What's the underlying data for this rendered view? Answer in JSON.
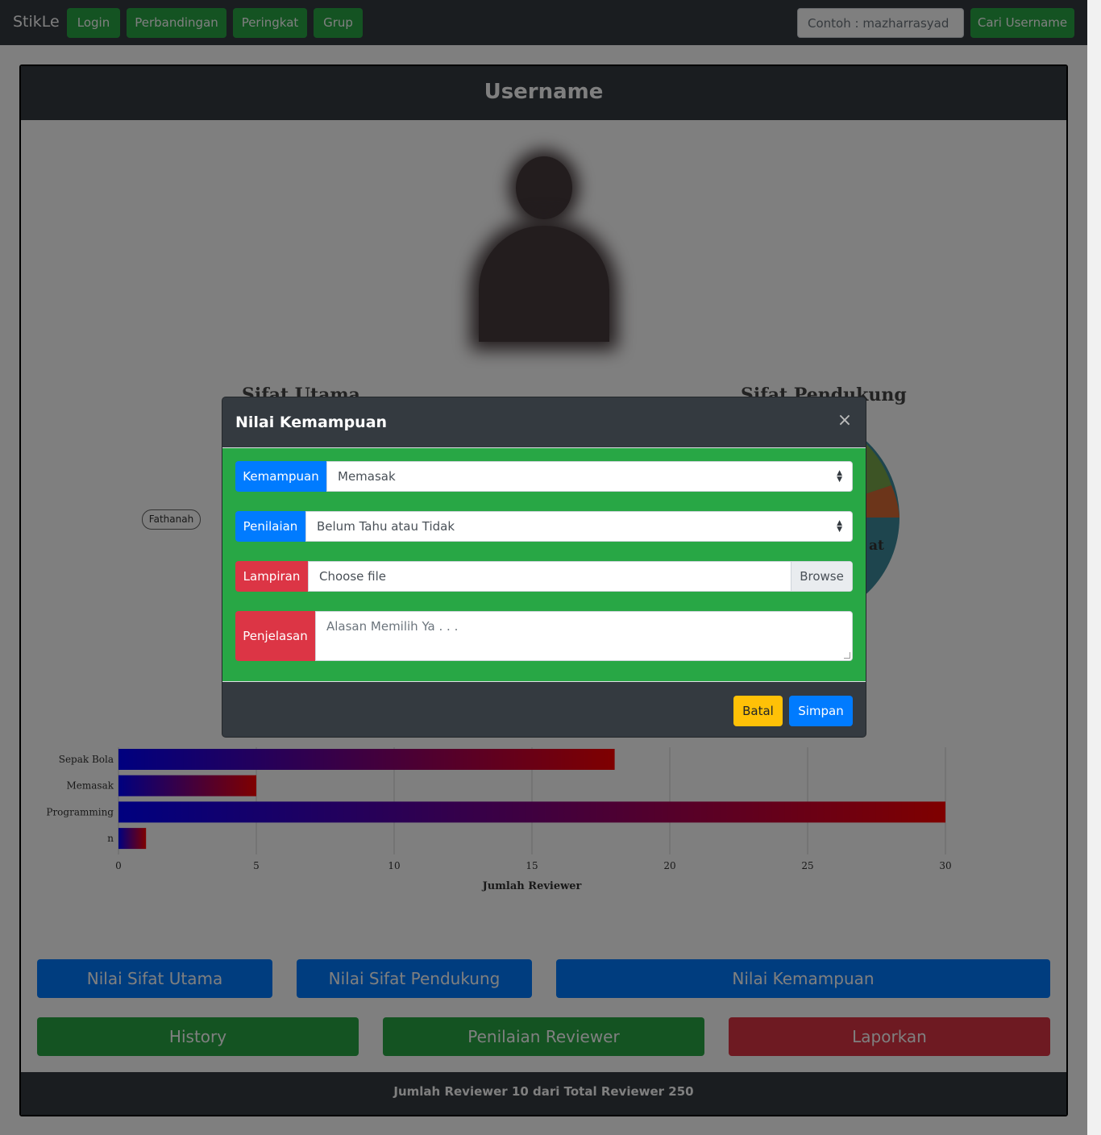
{
  "navbar": {
    "brand": "StikLe",
    "links": [
      "Login",
      "Perbandingan",
      "Peringkat",
      "Grup"
    ],
    "search_placeholder": "Contoh : mazharrasyad",
    "search_button": "Cari Username"
  },
  "card": {
    "header": "Username",
    "footer": "Jumlah Reviewer 10 dari Total Reviewer 250",
    "sifat_utama_title": "Sifat Utama",
    "sifat_pendukung_title": "Sifat Pendukung",
    "fathanah_label": "Fathanah",
    "pie_label": "at"
  },
  "chart_data": {
    "type": "bar",
    "orientation": "horizontal",
    "categories": [
      "Sepak Bola",
      "Memasak",
      "Programming",
      "n"
    ],
    "values": [
      18,
      5,
      30,
      1
    ],
    "xlabel": "Jumlah Reviewer",
    "xlim": [
      0,
      32
    ],
    "xticks": [
      0,
      5,
      10,
      15,
      20,
      25,
      30
    ],
    "grid": true,
    "colors": {
      "gradient_start": "#0000ff",
      "gradient_end": "#ff0000"
    }
  },
  "buttons": {
    "nilai_sifat_utama": "Nilai Sifat Utama",
    "nilai_sifat_pendukung": "Nilai Sifat Pendukung",
    "nilai_kemampuan": "Nilai Kemampuan",
    "history": "History",
    "penilaian_reviewer": "Penilaian Reviewer",
    "laporkan": "Laporkan"
  },
  "modal": {
    "title": "Nilai Kemampuan",
    "fields": {
      "kemampuan_label": "Kemampuan",
      "kemampuan_value": "Memasak",
      "penilaian_label": "Penilaian",
      "penilaian_value": "Belum Tahu atau Tidak",
      "lampiran_label": "Lampiran",
      "lampiran_value": "Choose file",
      "browse": "Browse",
      "penjelasan_label": "Penjelasan",
      "penjelasan_placeholder": "Alasan Memilih Ya . . ."
    },
    "batal": "Batal",
    "simpan": "Simpan"
  },
  "colors": {
    "primary": "#007bff",
    "success": "#28a745",
    "danger": "#dc3545",
    "warning": "#ffc107",
    "dark": "#343a40"
  }
}
